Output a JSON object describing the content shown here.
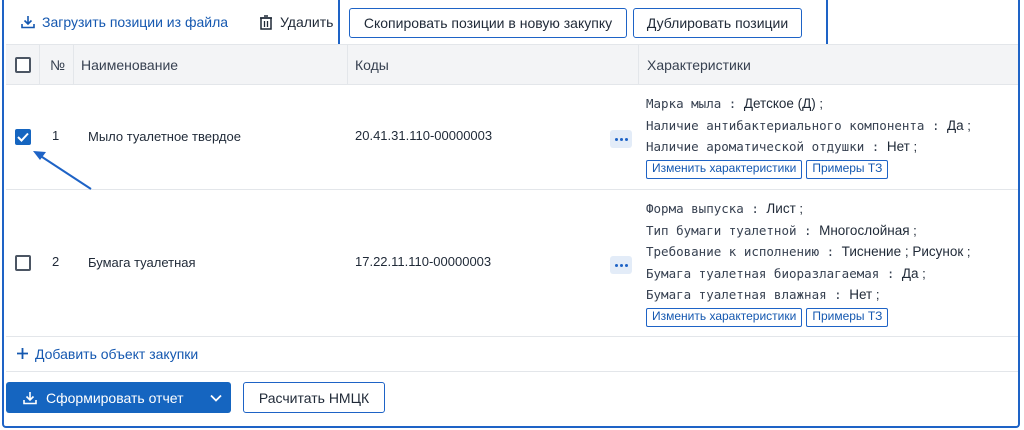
{
  "toolbar": {
    "upload_label": "Загрузить позиции из файла",
    "delete_label": "Удалить",
    "copy_label": "Скопировать позиции в новую закупку",
    "duplicate_label": "Дублировать позиции"
  },
  "table": {
    "headers": {
      "number": "№",
      "name": "Наименование",
      "codes": "Коды",
      "characteristics": "Характеристики"
    },
    "rows": [
      {
        "checked": true,
        "number": "1",
        "name": "Мыло туалетное твердое",
        "code": "20.41.31.110-00000003",
        "characteristics": [
          {
            "key": "Марка мыла",
            "value": "Детское (Д)"
          },
          {
            "key": "Наличие антибактериального компонента",
            "value": "Да"
          },
          {
            "key": "Наличие ароматической отдушки",
            "value": "Нет"
          }
        ],
        "edit_label": "Изменить характеристики",
        "examples_label": "Примеры ТЗ"
      },
      {
        "checked": false,
        "number": "2",
        "name": "Бумага туалетная",
        "code": "17.22.11.110-00000003",
        "characteristics": [
          {
            "key": "Форма выпуска",
            "value": "Лист"
          },
          {
            "key": "Тип бумаги туалетной",
            "value": "Многослойная"
          },
          {
            "key": "Требование к исполнению",
            "value": "Тиснение ; Рисунок"
          },
          {
            "key": "Бумага туалетная биоразлагаемая",
            "value": "Да"
          },
          {
            "key": "Бумага туалетная влажная",
            "value": "Нет"
          }
        ],
        "edit_label": "Изменить характеристики",
        "examples_label": "Примеры ТЗ"
      }
    ]
  },
  "add_object_label": "Добавить объект закупки",
  "footer": {
    "report_label": "Сформировать отчет",
    "calc_label": "Расчитать НМЦК"
  },
  "colors": {
    "accent": "#1565c0",
    "highlight": "#1e63c6"
  },
  "icons": {
    "upload": "download-tray-icon",
    "delete": "trash-icon",
    "add": "plus-icon",
    "more": "more-dots-icon",
    "caret": "chevron-down-icon"
  }
}
